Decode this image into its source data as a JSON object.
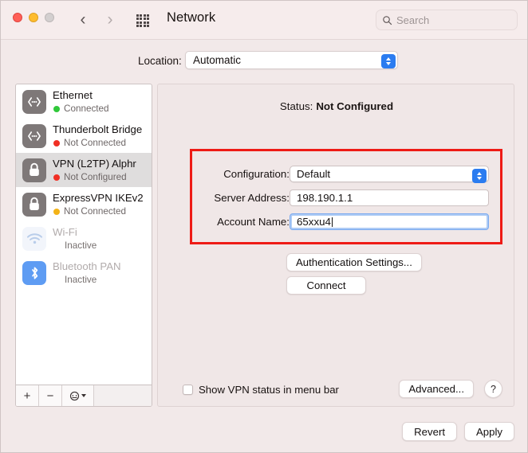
{
  "window": {
    "title": "Network",
    "traffic_lights": [
      "close",
      "minimize",
      "zoom"
    ]
  },
  "titlebar": {
    "back_glyph": "‹",
    "forward_glyph": "›",
    "grid_icon": "grid-icon",
    "search": {
      "placeholder": "Search",
      "icon": "search-icon"
    }
  },
  "location": {
    "label": "Location:",
    "value": "Automatic",
    "options": [
      "Automatic"
    ]
  },
  "sidebar": {
    "services": [
      {
        "name": "Ethernet",
        "status": "Connected",
        "status_color": "#30c83a",
        "icon": "ethernet-icon",
        "selected": false,
        "dim": false
      },
      {
        "name": "Thunderbolt Bridge",
        "status": "Not Connected",
        "status_color": "#f02f24",
        "icon": "ethernet-icon",
        "selected": false,
        "dim": false
      },
      {
        "name": "VPN (L2TP) Alphr",
        "status": "Not Configured",
        "status_color": "#f02f24",
        "icon": "lock-icon",
        "selected": true,
        "dim": false
      },
      {
        "name": "ExpressVPN IKEv2",
        "status": "Not Connected",
        "status_color": "#f3b317",
        "icon": "lock-icon",
        "selected": false,
        "dim": false
      },
      {
        "name": "Wi-Fi",
        "status": "Inactive",
        "status_color": "",
        "icon": "wifi-icon",
        "selected": false,
        "dim": true
      },
      {
        "name": "Bluetooth PAN",
        "status": "Inactive",
        "status_color": "",
        "icon": "bluetooth-icon",
        "selected": false,
        "dim": true
      }
    ],
    "footer": {
      "add_label": "+",
      "remove_label": "−",
      "action_icon": "gear-action-icon"
    }
  },
  "main": {
    "status_label": "Status:",
    "status_value": "Not Configured",
    "form": {
      "configuration_label": "Configuration:",
      "configuration_value": "Default",
      "configuration_options": [
        "Default"
      ],
      "server_address_label": "Server Address:",
      "server_address_value": "198.190.1.1",
      "account_name_label": "Account Name:",
      "account_name_value": "65xxu4"
    },
    "auth_button": "Authentication Settings...",
    "connect_button": "Connect",
    "show_vpn_status_label": "Show VPN status in menu bar",
    "show_vpn_status_checked": false,
    "advanced_button": "Advanced...",
    "help_button": "?"
  },
  "footer": {
    "revert_button": "Revert",
    "apply_button": "Apply"
  },
  "annotation": {
    "highlight_color": "#ee1b16"
  }
}
